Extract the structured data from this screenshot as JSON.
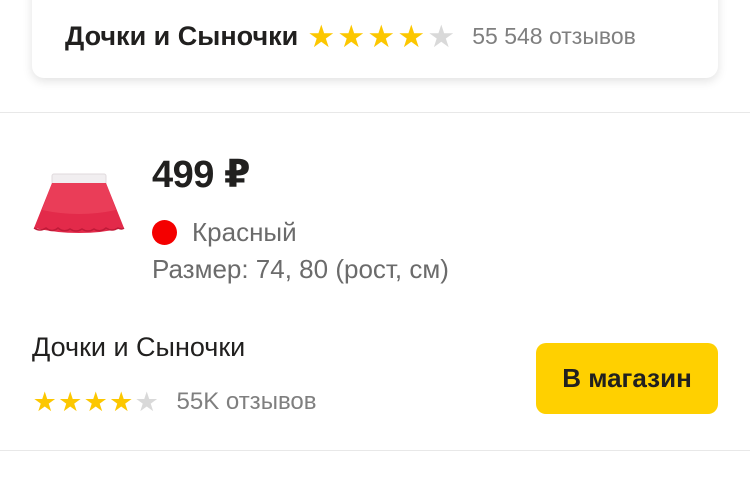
{
  "shop_card": {
    "name": "Дочки и Сыночки",
    "rating_stars": 4,
    "max_stars": 5,
    "reviews": "55 548 отзывов"
  },
  "offer": {
    "price": "499 ₽",
    "color_name": "Красный",
    "color_hex": "#f40000",
    "size": "Размер: 74, 80 (рост, см)",
    "thumbnail": "red-tulle-skirt-icon"
  },
  "seller": {
    "name": "Дочки и Сыночки",
    "rating_stars": 4,
    "max_stars": 5,
    "reviews": "55K отзывов",
    "button_label": "В магазин"
  },
  "colors": {
    "star_filled": "#fcc700",
    "star_empty": "#d9d9d9",
    "button_bg": "#ffd000",
    "text_primary": "#21201f",
    "text_secondary": "#7f7f7f"
  }
}
